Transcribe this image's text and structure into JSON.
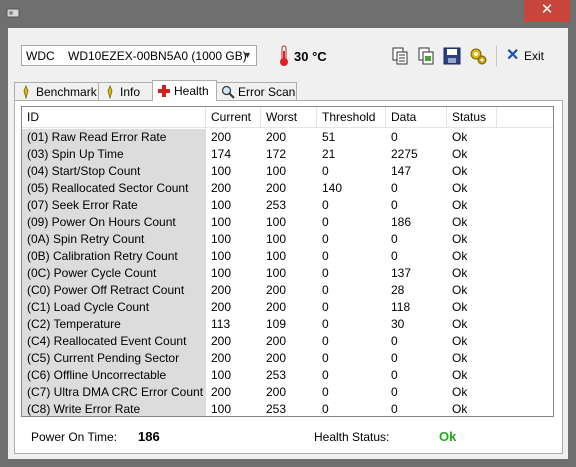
{
  "window": {
    "title": "",
    "close_glyph": "✕"
  },
  "toolbar": {
    "drive_brand": "WDC",
    "drive_model": "WD10EZEX-00BN5A0 (1000 GB)",
    "temperature": "30 °C",
    "exit_label": "Exit",
    "icons": [
      "copy-icon",
      "copy-screenshot-icon",
      "save-icon",
      "options-icon",
      "exit-icon"
    ]
  },
  "tabs": [
    {
      "label": "Benchmark",
      "icon": "benchmark-icon"
    },
    {
      "label": "Info",
      "icon": "info-icon"
    },
    {
      "label": "Health",
      "icon": "health-cross-icon",
      "active": true
    },
    {
      "label": "Error Scan",
      "icon": "magnifier-icon"
    }
  ],
  "table": {
    "columns": [
      "ID",
      "Current",
      "Worst",
      "Threshold",
      "Data",
      "Status"
    ],
    "rows": [
      {
        "id": "(01) Raw Read Error Rate",
        "current": "200",
        "worst": "200",
        "threshold": "51",
        "data": "0",
        "status": "Ok"
      },
      {
        "id": "(03) Spin Up Time",
        "current": "174",
        "worst": "172",
        "threshold": "21",
        "data": "2275",
        "status": "Ok"
      },
      {
        "id": "(04) Start/Stop Count",
        "current": "100",
        "worst": "100",
        "threshold": "0",
        "data": "147",
        "status": "Ok"
      },
      {
        "id": "(05) Reallocated Sector Count",
        "current": "200",
        "worst": "200",
        "threshold": "140",
        "data": "0",
        "status": "Ok"
      },
      {
        "id": "(07) Seek Error Rate",
        "current": "100",
        "worst": "253",
        "threshold": "0",
        "data": "0",
        "status": "Ok"
      },
      {
        "id": "(09) Power On Hours Count",
        "current": "100",
        "worst": "100",
        "threshold": "0",
        "data": "186",
        "status": "Ok"
      },
      {
        "id": "(0A) Spin Retry Count",
        "current": "100",
        "worst": "100",
        "threshold": "0",
        "data": "0",
        "status": "Ok"
      },
      {
        "id": "(0B) Calibration Retry Count",
        "current": "100",
        "worst": "100",
        "threshold": "0",
        "data": "0",
        "status": "Ok"
      },
      {
        "id": "(0C) Power Cycle Count",
        "current": "100",
        "worst": "100",
        "threshold": "0",
        "data": "137",
        "status": "Ok"
      },
      {
        "id": "(C0) Power Off Retract Count",
        "current": "200",
        "worst": "200",
        "threshold": "0",
        "data": "28",
        "status": "Ok"
      },
      {
        "id": "(C1) Load Cycle Count",
        "current": "200",
        "worst": "200",
        "threshold": "0",
        "data": "118",
        "status": "Ok"
      },
      {
        "id": "(C2) Temperature",
        "current": "113",
        "worst": "109",
        "threshold": "0",
        "data": "30",
        "status": "Ok"
      },
      {
        "id": "(C4) Reallocated Event Count",
        "current": "200",
        "worst": "200",
        "threshold": "0",
        "data": "0",
        "status": "Ok"
      },
      {
        "id": "(C5) Current Pending Sector",
        "current": "200",
        "worst": "200",
        "threshold": "0",
        "data": "0",
        "status": "Ok"
      },
      {
        "id": "(C6) Offline Uncorrectable",
        "current": "100",
        "worst": "253",
        "threshold": "0",
        "data": "0",
        "status": "Ok"
      },
      {
        "id": "(C7) Ultra DMA CRC Error Count",
        "current": "200",
        "worst": "200",
        "threshold": "0",
        "data": "0",
        "status": "Ok"
      },
      {
        "id": "(C8) Write Error Rate",
        "current": "100",
        "worst": "253",
        "threshold": "0",
        "data": "0",
        "status": "Ok"
      }
    ]
  },
  "status": {
    "power_on_label": "Power On Time:",
    "power_on_value": "186",
    "health_label": "Health Status:",
    "health_value": "Ok",
    "health_color": "#22a81c"
  }
}
